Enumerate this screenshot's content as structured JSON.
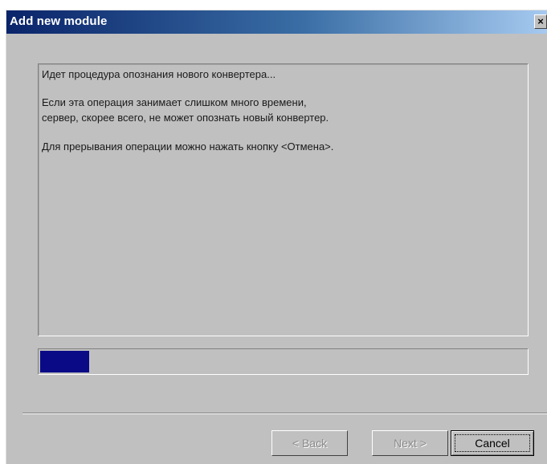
{
  "window": {
    "title": "Add new module",
    "close_glyph": "×",
    "close_icon": "close-icon"
  },
  "message": {
    "lines": [
      "Идет процедура опознания нового конвертера...",
      "Если эта операция занимает слишком много времени,",
      "сервер, скорее всего, не может опознать новый конвертер.",
      "Для прерывания операции можно нажать кнопку <Отмена>."
    ]
  },
  "progress": {
    "fraction": 0.1,
    "fill_color": "#0a0a86"
  },
  "buttons": {
    "back_label": "< Back",
    "next_label": "Next >",
    "cancel_label": "Cancel"
  },
  "colors": {
    "dialog_face": "#c0c0c0",
    "titlebar_start": "#0a246a",
    "titlebar_end": "#a6caf0"
  }
}
